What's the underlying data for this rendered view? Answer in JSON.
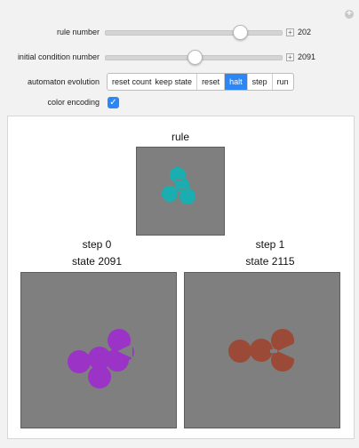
{
  "controls": {
    "rule_number": {
      "label": "rule number",
      "value": "202"
    },
    "initial_condition": {
      "label": "initial condition number",
      "value": "2091"
    },
    "automaton_evolution": {
      "label": "automaton evolution",
      "buttons": [
        "reset count",
        "keep state",
        "reset",
        "halt",
        "step",
        "run"
      ],
      "active": "halt"
    },
    "color_encoding": {
      "label": "color encoding",
      "checked": true,
      "checkmark": "✓"
    }
  },
  "output": {
    "rule_title": "rule",
    "step0": {
      "step_label": "step 0",
      "state_label": "state 2091"
    },
    "step1": {
      "step_label": "step 1",
      "state_label": "state 2115"
    }
  },
  "colors": {
    "rule_cells": "#1aaeb0",
    "step0_cells": "#9a33c6",
    "step1_cells": "#9a4a36",
    "gray_background": "#7f7f7f",
    "accent": "#2d86f5"
  }
}
